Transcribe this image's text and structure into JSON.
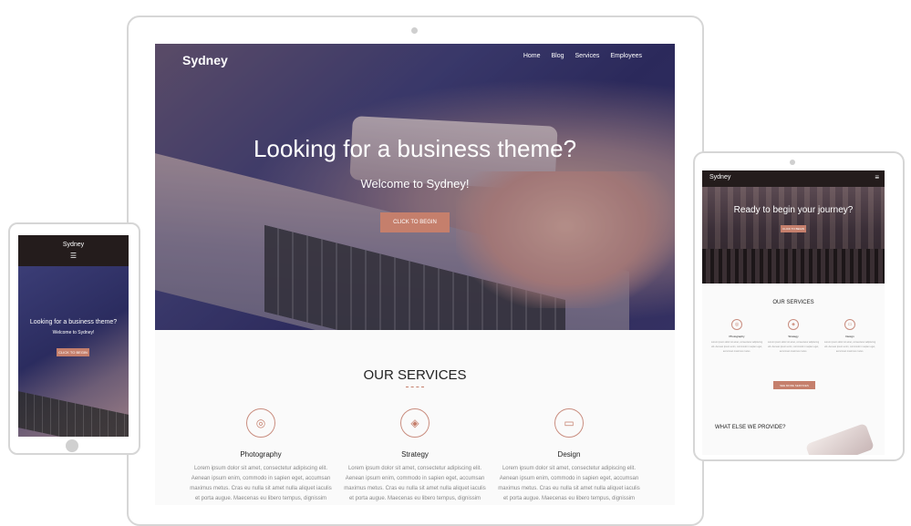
{
  "desktop": {
    "logo": "Sydney",
    "nav": [
      "Home",
      "Blog",
      "Services",
      "Employees"
    ],
    "hero_title": "Looking for a business theme?",
    "hero_subtitle": "Welcome to Sydney!",
    "hero_button": "CLICK TO BEGIN",
    "services_heading": "OUR SERVICES",
    "services": [
      {
        "title": "Photography",
        "icon": "camera-icon",
        "text": "Lorem ipsum dolor sit amet, consectetur adipiscing elit. Aenean ipsum enim, commodo in sapien eget, accumsan maximus metus. Cras eu nulla sit amet nulla aliquet iaculis et porta augue. Maecenas eu libero tempus, dignissim"
      },
      {
        "title": "Strategy",
        "icon": "cube-icon",
        "text": "Lorem ipsum dolor sit amet, consectetur adipiscing elit. Aenean ipsum enim, commodo in sapien eget, accumsan maximus metus. Cras eu nulla sit amet nulla aliquet iaculis et porta augue. Maecenas eu libero tempus, dignissim"
      },
      {
        "title": "Design",
        "icon": "monitor-icon",
        "text": "Lorem ipsum dolor sit amet, consectetur adipiscing elit. Aenean ipsum enim, commodo in sapien eget, accumsan maximus metus. Cras eu nulla sit amet nulla aliquet iaculis et porta augue. Maecenas eu libero tempus, dignissim"
      }
    ]
  },
  "tablet": {
    "logo": "Sydney",
    "menu_icon": "hamburger-icon",
    "hero_title": "Looking for a business theme?",
    "hero_subtitle": "Welcome to Sydney!",
    "hero_button": "CLICK TO BEGIN"
  },
  "phone": {
    "logo": "Sydney",
    "menu_icon": "hamburger-icon",
    "hero_title": "Ready to begin your journey?",
    "hero_button": "CLICK TO BEGIN",
    "services_heading": "OUR SERVICES",
    "services": [
      {
        "title": "Photography",
        "text": "Lorem ipsum dolor sit amet, consectetur adipiscing elit. Aenean ipsum enim, commodo in sapien eget, accumsan maximus metus."
      },
      {
        "title": "Strategy",
        "text": "Lorem ipsum dolor sit amet, consectetur adipiscing elit. Aenean ipsum enim, commodo in sapien eget, accumsan maximus metus."
      },
      {
        "title": "Design",
        "text": "Lorem ipsum dolor sit amet, consectetur adipiscing elit. Aenean ipsum enim, commodo in sapien eget, accumsan maximus metus."
      }
    ],
    "services_button": "SEE MORE SERVICES",
    "else_heading": "WHAT ELSE WE PROVIDE?"
  },
  "colors": {
    "accent": "#c57f6c",
    "header_dark": "#241c1c",
    "hero_navy": "#2d2d62"
  }
}
